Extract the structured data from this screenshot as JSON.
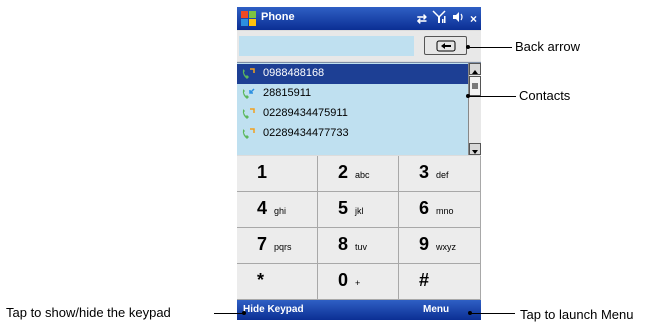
{
  "window": {
    "title": "Phone",
    "status_icons": [
      "sync-icon",
      "signal-icon",
      "volume-icon",
      "close-icon"
    ],
    "close_label": "×"
  },
  "dialer": {
    "number_value": "",
    "back_icon": "back-arrow-icon"
  },
  "contacts": [
    {
      "number": "0988488168",
      "selected": true
    },
    {
      "number": "28815911",
      "selected": false
    },
    {
      "number": "02289434475911",
      "selected": false
    },
    {
      "number": "02289434477733",
      "selected": false
    }
  ],
  "keypad": [
    {
      "digit": "1",
      "letters": ""
    },
    {
      "digit": "2",
      "letters": "abc"
    },
    {
      "digit": "3",
      "letters": "def"
    },
    {
      "digit": "4",
      "letters": "ghi"
    },
    {
      "digit": "5",
      "letters": "jkl"
    },
    {
      "digit": "6",
      "letters": "mno"
    },
    {
      "digit": "7",
      "letters": "pqrs"
    },
    {
      "digit": "8",
      "letters": "tuv"
    },
    {
      "digit": "9",
      "letters": "wxyz"
    },
    {
      "digit": "*",
      "letters": ""
    },
    {
      "digit": "0",
      "letters": "+"
    },
    {
      "digit": "#",
      "letters": ""
    }
  ],
  "menubar": {
    "left": "Hide Keypad",
    "right": "Menu"
  },
  "callouts": {
    "back_arrow": "Back arrow",
    "contacts": "Contacts",
    "keypad": "Tap to show/hide the keypad",
    "menu": "Tap to launch Menu"
  },
  "colors": {
    "titlebar": "#1f4bb3",
    "list_bg": "#bfe0f0",
    "selected_row": "#1d3f94"
  }
}
